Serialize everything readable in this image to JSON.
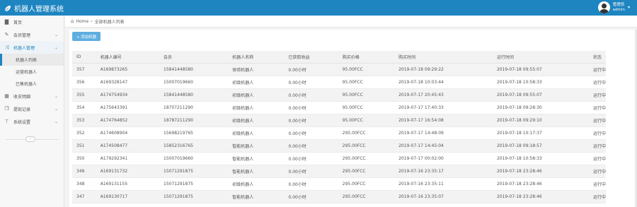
{
  "app": {
    "title": "机器人管理系统"
  },
  "user": {
    "role": "管理员",
    "name": "admin",
    "caret": "▾"
  },
  "sidebar": {
    "items": [
      {
        "icon": "▇",
        "label": "首页"
      },
      {
        "icon": "✎",
        "label": "会员管理"
      },
      {
        "icon": "⤨",
        "label": "机器人管理"
      },
      {
        "icon": "▦",
        "label": "收支明细"
      },
      {
        "icon": "❐",
        "label": "提现记录"
      },
      {
        "icon": "⊤",
        "label": "系统设置"
      }
    ],
    "sub_items": [
      "机器人列表",
      "运营机器人",
      "已售机器人"
    ],
    "chevron": "⌄",
    "collapse_glyph": "‹"
  },
  "breadcrumb": {
    "home": "Home",
    "separator": "›",
    "current": "全部机器人列表"
  },
  "toolbar": {
    "add_label": "+ 添加机器"
  },
  "table": {
    "columns": [
      "ID",
      "机器人编号",
      "会员",
      "机器人名称",
      "已获取收益",
      "购买价格",
      "购买时间",
      "运行时间",
      "状态"
    ],
    "rows": [
      [
        "357",
        "A169873265",
        "15841448580",
        "体验机器人",
        "0.00小时",
        "95.00FCC",
        "2019-07-18 09:29:22",
        "2019-07-18 09:55:07",
        "运行中"
      ],
      [
        "356",
        "A169328147",
        "15007019660",
        "初级机器人",
        "0.00小时",
        "95.00FCC",
        "2019-07-18 10:03:44",
        "2019-07-18 10:58:33",
        "运行中"
      ],
      [
        "355",
        "A174754934",
        "15841448580",
        "初级机器人",
        "0.00小时",
        "95.00FCC",
        "2019-07-17 20:45:43",
        "2019-07-18 09:55:07",
        "运行中"
      ],
      [
        "354",
        "A175643391",
        "18707211290",
        "初级机器人",
        "0.00小时",
        "95.00FCC",
        "2019-07-17 17:40:33",
        "2019-07-18 09:28:30",
        "运行中"
      ],
      [
        "353",
        "A174764852",
        "18787211290",
        "初级机器人",
        "0.00小时",
        "95.00FCC",
        "2019-07-17 16:54:08",
        "2019-07-18 09:29:10",
        "运行中"
      ],
      [
        "352",
        "A174608904",
        "15698219765",
        "初级机器人",
        "0.00小时",
        "295.00FCC",
        "2019-07-17 14:48:09",
        "2019-07-18 10:17:37",
        "运行中"
      ],
      [
        "351",
        "A174508477",
        "15852316765",
        "智能机器人",
        "0.00小时",
        "295.00FCC",
        "2019-07-17 14:45:04",
        "2019-07-18 09:18:57",
        "运行中"
      ],
      [
        "350",
        "A179292341",
        "15007019660",
        "智能机器人",
        "0.00小时",
        "295.00FCC",
        "2019-07-17 00:02:00",
        "2019-07-18 10:58:33",
        "运行中"
      ],
      [
        "349",
        "A169131732",
        "15071291875",
        "智能机器人",
        "0.00小时",
        "295.00FCC",
        "2019-07-16 23:35:17",
        "2019-07-18 23:28:46",
        "运行中"
      ],
      [
        "348",
        "A169131155",
        "15071291875",
        "初级机器人",
        "0.00小时",
        "295.00FCC",
        "2019-07-16 23:35:11",
        "2019-07-18 23:28:46",
        "运行中"
      ],
      [
        "347",
        "A169130717",
        "15071291875",
        "智能机器人",
        "0.00小时",
        "295.00FCC",
        "2019-07-16 23:35:07",
        "2019-07-18 23:28:46",
        "运行中"
      ]
    ]
  }
}
